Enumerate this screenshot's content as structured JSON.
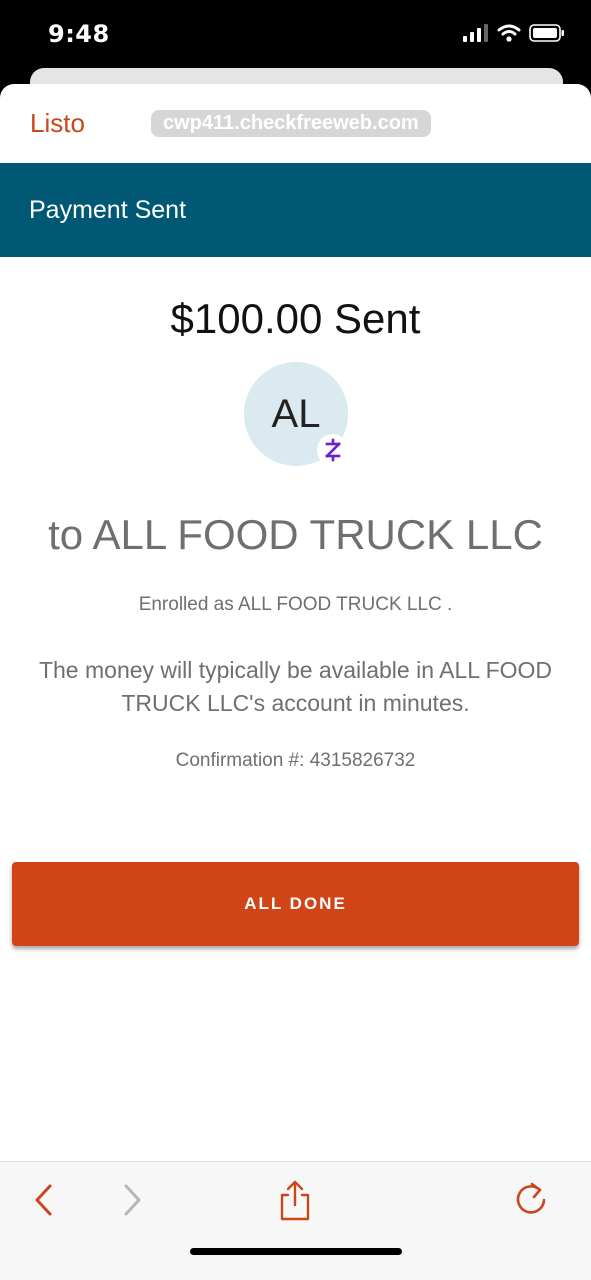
{
  "status_bar": {
    "time": "9:48"
  },
  "browser": {
    "done_label": "Listo",
    "url": "cwp411.checkfreeweb.com"
  },
  "header": {
    "title": "Payment Sent"
  },
  "payment": {
    "amount_text": "$100.00 Sent",
    "avatar_initials": "AL",
    "recipient_text": "to ALL FOOD TRUCK LLC",
    "enrolled_text": "Enrolled as ALL FOOD TRUCK LLC .",
    "availability_text": "The money will typically be available in ALL FOOD TRUCK LLC's account in minutes.",
    "confirmation_text": "Confirmation #: 4315826732"
  },
  "actions": {
    "all_done_label": "ALL DONE"
  },
  "icons": {
    "zelle": "zelle-logo-icon",
    "back": "chevron-left-icon",
    "forward": "chevron-right-icon",
    "share": "share-icon",
    "reload": "reload-icon"
  },
  "colors": {
    "accent": "#d04415",
    "header_band": "#005874",
    "zelle_purple": "#6d1ed4"
  }
}
